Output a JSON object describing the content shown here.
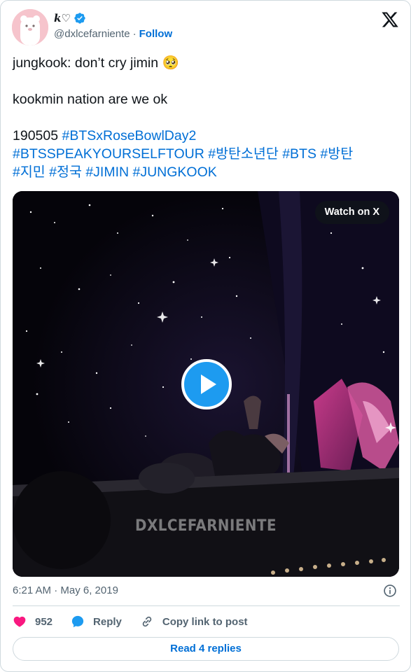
{
  "author": {
    "display_name": "𝒌♡",
    "handle": "@dxlcefarniente",
    "separator": "·",
    "follow_label": "Follow"
  },
  "tweet": {
    "line1_text": "jungkook: don’t cry jimin",
    "line1_emoji": "🥺",
    "line2": "kookmin nation are we ok",
    "date_code": "190505",
    "hashtags_line1": [
      "#BTSxRoseBowlDay2"
    ],
    "hashtags_line2": [
      "#BTSSPEAKYOURSELFTOUR",
      "#방탄소년단",
      "#BTS",
      "#방탄"
    ],
    "hashtags_line3": [
      "#지민",
      "#정국",
      "#JIMIN",
      "#JUNGKOOK"
    ]
  },
  "media": {
    "watch_label": "Watch on X",
    "watermark": "DXLCEFARNIENTE",
    "play_icon": "play-icon"
  },
  "meta": {
    "timestamp": "6:21 AM · May 6, 2019"
  },
  "actions": {
    "like_count": "952",
    "reply_label": "Reply",
    "copy_label": "Copy link to post"
  },
  "footer": {
    "read_replies_label": "Read 4 replies"
  },
  "colors": {
    "accent": "#006fd6",
    "like": "#f91880",
    "verified": "#1d9bf0",
    "muted": "#536471"
  }
}
